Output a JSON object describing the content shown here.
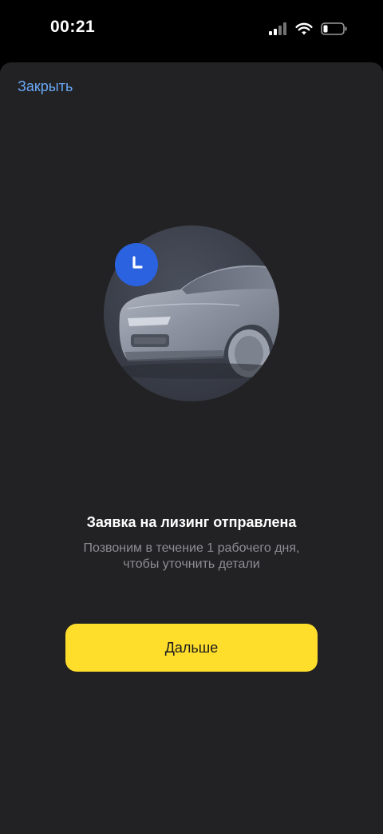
{
  "status_bar": {
    "time": "00:21",
    "icons": [
      "cellular-signal-icon",
      "wifi-icon",
      "battery-icon"
    ]
  },
  "sheet": {
    "close_label": "Закрыть",
    "illustration": {
      "main": "car-icon",
      "badge": "clock-icon"
    },
    "title": "Заявка на лизинг отправлена",
    "subtitle_line1": "Позвоним в течение 1 рабочего дня,",
    "subtitle_line2": "чтобы уточнить детали",
    "next_button_label": "Дальше"
  },
  "colors": {
    "background": "#000000",
    "sheet": "#222224",
    "link": "#6aa8f5",
    "button": "#fedd2b",
    "badge": "#2a62e0",
    "subtitle": "#8e8e93"
  }
}
